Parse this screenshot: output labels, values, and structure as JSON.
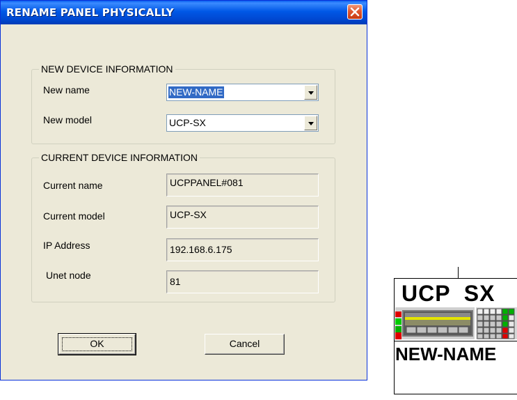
{
  "dialog": {
    "title": "RENAME PANEL PHYSICALLY",
    "new_device": {
      "legend": "NEW DEVICE INFORMATION",
      "name_label": "New name",
      "name_value": "NEW-NAME",
      "model_label": "New model",
      "model_value": "UCP-SX"
    },
    "current_device": {
      "legend": "CURRENT DEVICE INFORMATION",
      "name_label": "Current name",
      "name_value": "UCPPANEL#081",
      "model_label": "Current model",
      "model_value": "UCP-SX",
      "ip_label": "IP Address",
      "ip_value": "192.168.6.175",
      "unet_label": "Unet node",
      "unet_value": "81"
    },
    "buttons": {
      "ok": "OK",
      "cancel": "Cancel"
    }
  },
  "device_icon": {
    "model_text": "UCP  SX",
    "name_text": "NEW-NAME"
  },
  "colors": {
    "titlebar": "#0058e6",
    "dialog_bg": "#ece9d8",
    "selection": "#316ac5",
    "close_button": "#e0562f"
  }
}
